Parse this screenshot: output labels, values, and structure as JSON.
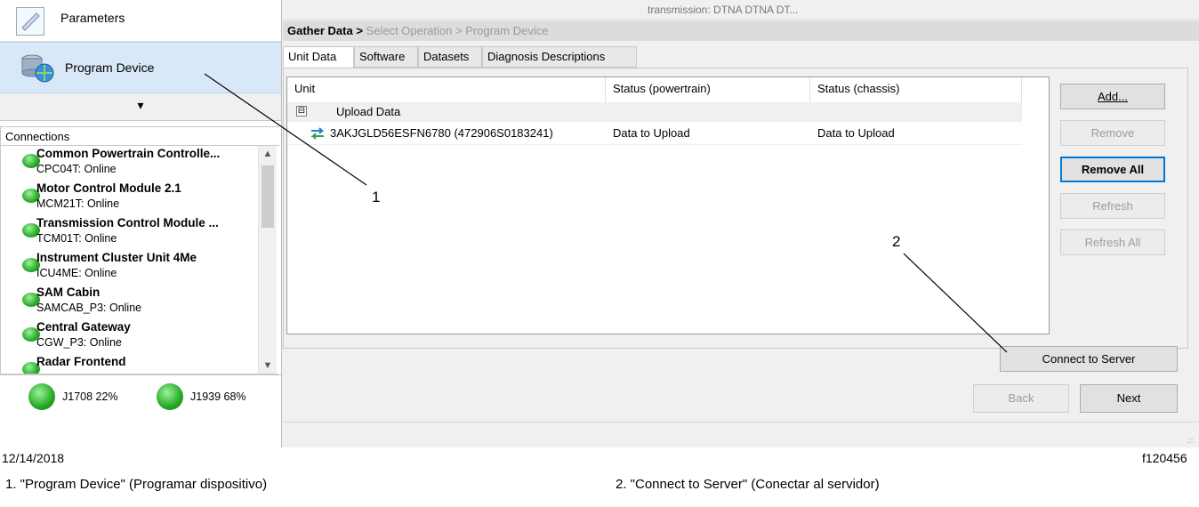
{
  "window": {
    "title_fragment": "transmission: DTNA DTNA DT..."
  },
  "sidebar": {
    "items": [
      {
        "label": "Parameters"
      },
      {
        "label": "Program Device"
      }
    ],
    "collapse_glyph": "▾",
    "connections_header": "Connections",
    "connections": [
      {
        "name": "Common Powertrain Controlle...",
        "status": "CPC04T: Online"
      },
      {
        "name": "Motor Control Module 2.1",
        "status": "MCM21T: Online"
      },
      {
        "name": "Transmission Control Module ...",
        "status": "TCM01T: Online"
      },
      {
        "name": "Instrument Cluster Unit 4Me",
        "status": "ICU4ME: Online"
      },
      {
        "name": "SAM Cabin",
        "status": "SAMCAB_P3: Online"
      },
      {
        "name": "Central Gateway",
        "status": "CGW_P3: Online"
      },
      {
        "name": "Radar Frontend",
        "status": ""
      }
    ],
    "bus_status": [
      {
        "label": "J1708 22%"
      },
      {
        "label": "J1939 68%"
      }
    ]
  },
  "breadcrumb": {
    "current": "Gather Data",
    "separator": ">",
    "steps": [
      "Select Operation",
      "Program Device"
    ]
  },
  "tabs": [
    {
      "label": "Unit Data",
      "active": true
    },
    {
      "label": "Software"
    },
    {
      "label": "Datasets"
    },
    {
      "label": "Diagnosis Descriptions"
    }
  ],
  "table": {
    "columns": [
      "Unit",
      "Status (powertrain)",
      "Status (chassis)"
    ],
    "group": {
      "toggle": "⊟",
      "label": "Upload Data"
    },
    "rows": [
      {
        "unit": "3AKJGLD56ESFN6780 (472906S0183241)",
        "powertrain": "Data to Upload",
        "chassis": "Data to Upload"
      }
    ]
  },
  "side_buttons": {
    "add": {
      "label": "Add..."
    },
    "remove": {
      "label": "Remove"
    },
    "remove_all": {
      "label": "Remove All"
    },
    "refresh": {
      "label": "Refresh"
    },
    "refresh_all": {
      "label": "Refresh All"
    }
  },
  "connect_button": {
    "label": "Connect to Server"
  },
  "nav_buttons": {
    "back": {
      "label": "Back"
    },
    "next": {
      "label": "Next"
    }
  },
  "figure": {
    "date": "12/14/2018",
    "figure_id": "f120456",
    "callout_1": "1",
    "callout_2": "2",
    "captions": [
      "1.   \"Program Device\" (Programar dispositivo)",
      "2.   \"Connect to Server\" (Conectar al servidor)"
    ]
  },
  "colors": {
    "selected_nav": "#d9e8f9",
    "led_green": "#24a824",
    "focus_border": "#0078d7"
  }
}
